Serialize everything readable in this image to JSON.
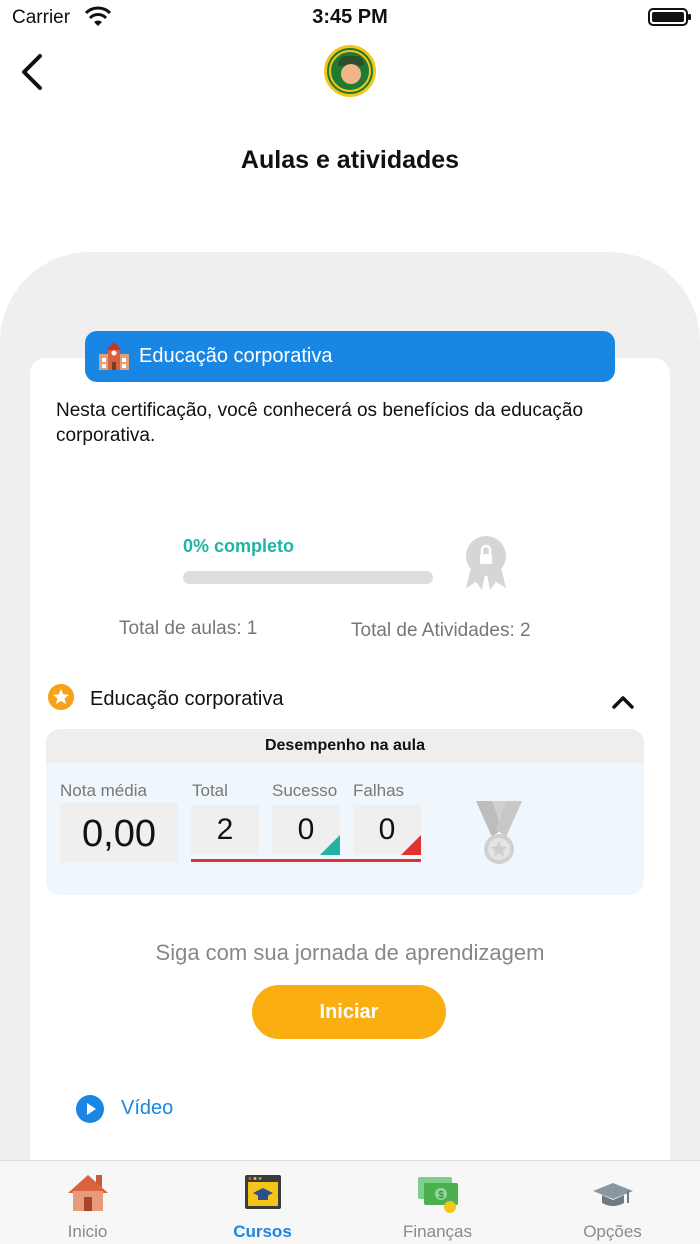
{
  "status_bar": {
    "carrier": "Carrier",
    "time": "3:45 PM"
  },
  "header": {
    "title": "Aulas e atividades"
  },
  "course": {
    "banner_title": "Educação corporativa",
    "description": "Nesta certificação, você conhecerá os benefícios da educação corporativa.",
    "progress_label": "0% completo",
    "progress_percent": 0,
    "total_lessons": "Total de aulas: 1",
    "total_activities": "Total de Atividades: 2"
  },
  "lesson": {
    "title": "Educação corporativa",
    "performance": {
      "heading": "Desempenho na aula",
      "nota_label": "Nota média",
      "nota_value": "0,00",
      "total_label": "Total",
      "total_value": "2",
      "success_label": "Sucesso",
      "success_value": "0",
      "fail_label": "Falhas",
      "fail_value": "0"
    },
    "journey_text": "Siga com sua jornada de aprendizagem",
    "start_button": "Iniciar",
    "video_label": "Vídeo"
  },
  "tabs": [
    {
      "label": "Inicio",
      "icon": "home-icon",
      "active": false
    },
    {
      "label": "Cursos",
      "icon": "courses-icon",
      "active": true
    },
    {
      "label": "Finanças",
      "icon": "money-icon",
      "active": false
    },
    {
      "label": "Opções",
      "icon": "graduation-cap-icon",
      "active": false
    }
  ],
  "colors": {
    "accent_blue": "#1a86e3",
    "progress_teal": "#20b3a1",
    "button_orange": "#fbae11",
    "fail_red": "#e23131"
  }
}
